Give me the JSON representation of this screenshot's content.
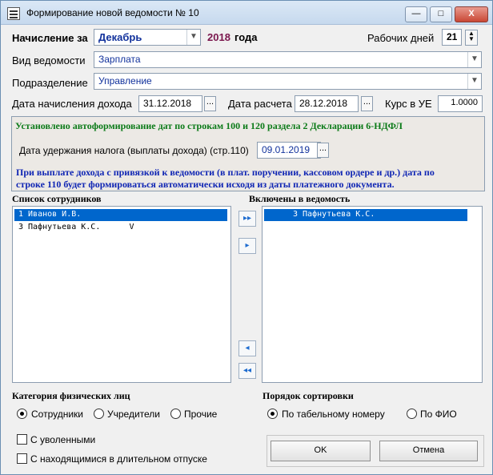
{
  "window": {
    "title": "Формирование новой ведомости № 10",
    "min": "—",
    "max": "□",
    "close": "X"
  },
  "header": {
    "accrual_label": "Начисление за",
    "month": "Декабрь",
    "year": "2018",
    "year_suffix": "года",
    "workdays_label": "Рабочих дней",
    "workdays": "21"
  },
  "form": {
    "statement_type_label": "Вид ведомости",
    "statement_type": "Зарплата",
    "department_label": "Подразделение",
    "department": "Управление",
    "income_date_label": "Дата начисления дохода",
    "income_date": "31.12.2018",
    "calc_date_label": "Дата расчета",
    "calc_date": "28.12.2018",
    "rate_label": "Курс в УЕ",
    "rate": "1.0000",
    "dots": "..."
  },
  "info": {
    "auto_text": "Установлено автоформирование дат по строкам 100 и 120 раздела 2 Декларации 6-НДФЛ",
    "tax_date_label": "Дата удержания налога (выплаты дохода) (стр.110)",
    "tax_date": "09.01.2019",
    "note_line1": "При выплате дохода с привязкой к ведомости (в плат. поручении, кассовом ордере и др.) дата по",
    "note_line2": "строке 110 будет формироваться автоматически исходя из даты платежного документа."
  },
  "lists": {
    "left_title": "Список сотрудников",
    "left_items": [
      "1 Иванов И.В.",
      "3 Пафнутьева К.С.      V"
    ],
    "right_title": "Включены в ведомость",
    "right_items": [
      "3 Пафнутьева К.С."
    ],
    "arrows": {
      "all_right": "▸▸",
      "one_right": "▸",
      "one_left": "◂",
      "all_left": "◂◂"
    }
  },
  "category": {
    "title": "Категория физических лиц",
    "options": [
      "Сотрудники",
      "Учредители",
      "Прочие"
    ],
    "selected": "Сотрудники"
  },
  "sort": {
    "title": "Порядок сортировки",
    "options": [
      "По табельному номеру",
      "По ФИО"
    ],
    "selected": "По табельному номеру"
  },
  "checkboxes": {
    "dismissed": "С уволенными",
    "long_leave": "С находящимися в длительном отпуске"
  },
  "buttons": {
    "ok": "OK",
    "cancel": "Отмена"
  }
}
